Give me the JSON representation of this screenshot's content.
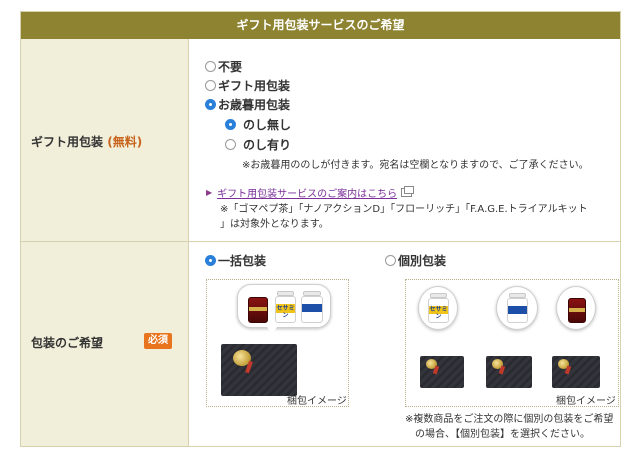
{
  "section_title": "ギフト用包装サービスのご希望",
  "gift_wrap_row": {
    "label": "ギフト用包装",
    "free_tag": "(無料)",
    "options": [
      {
        "label": "不要",
        "checked": false
      },
      {
        "label": "ギフト用包装",
        "checked": false
      },
      {
        "label": "お歳暮用包装",
        "checked": true
      }
    ],
    "noshi_options": [
      {
        "label": "のし無し",
        "checked": true
      },
      {
        "label": "のし有り",
        "checked": false
      }
    ],
    "noshi_note": "※お歳暮用ののしが付きます。宛名は空欄となりますので、ご了承ください。",
    "guide_link": "ギフト用包装サービスのご案内はこちら",
    "exclusion_note_line1": "※「ゴマペプ茶」「ナノアクションD」「フローリッチ」「F.A.G.E.トライアルキット",
    "exclusion_note_line2": "」は対象外となります。"
  },
  "packaging_row": {
    "label": "包装のご希望",
    "required_badge": "必須",
    "options": [
      {
        "label": "一括包装",
        "checked": true,
        "caption": "梱包イメージ"
      },
      {
        "label": "個別包装",
        "checked": false,
        "caption": "梱包イメージ"
      }
    ],
    "note_line1": "※複数商品をご注文の際に個別の包装をご希望",
    "note_line2": "の場合、【個別包装】を選択ください。"
  },
  "product_labels": {
    "sesamin": "セサミン",
    "multi": "マルチビタミン"
  },
  "icons": [
    "radio-icon",
    "arrow-icon",
    "external-window-icon",
    "gift-box-icon",
    "supplement-bottle-icon"
  ],
  "colors": {
    "header_bg": "#8d8331",
    "label_bg": "#f1efd9",
    "free_tag": "#c8641e",
    "required_badge": "#e8741e",
    "radio_selected": "#2a7fd9",
    "link": "#7a2f9a"
  }
}
